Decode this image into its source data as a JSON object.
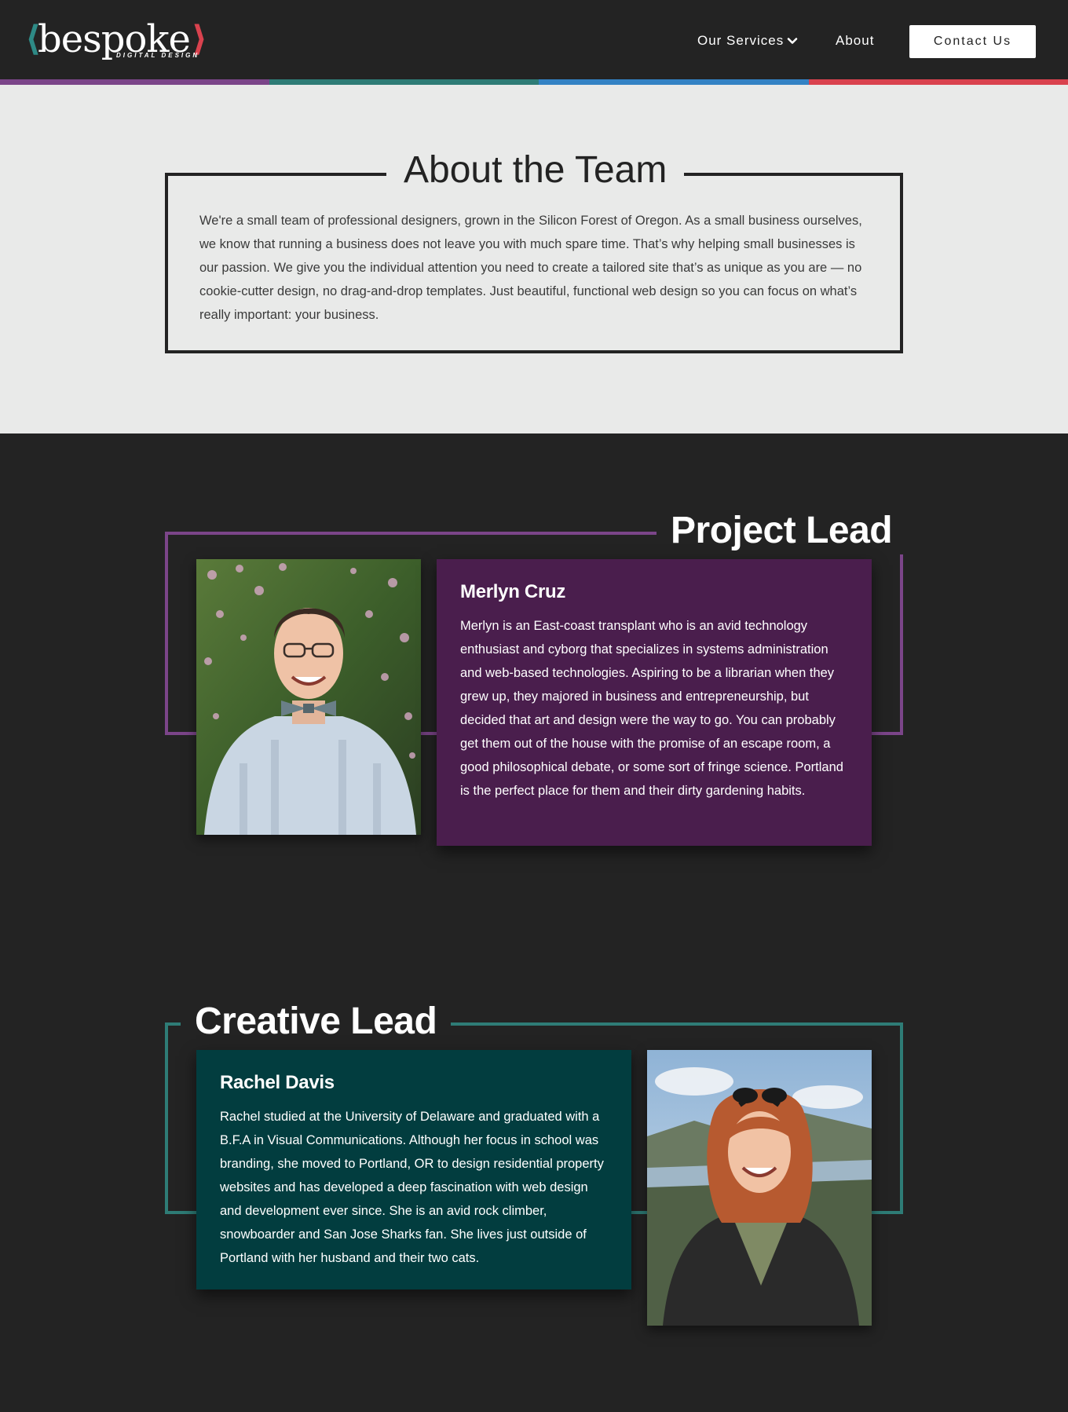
{
  "brand": {
    "logo_text": "bespoke",
    "logo_subtitle": "DIGITAL DESIGN",
    "bracket_left": "⟨",
    "bracket_right": "⟩",
    "colors": {
      "purple": "#7b4589",
      "teal": "#2e7c76",
      "blue": "#3382c4",
      "red": "#d9424e",
      "dark": "#232323",
      "light": "#e9eae9"
    }
  },
  "nav": {
    "services_label": "Our Services",
    "services_icon": "chevron-down-icon",
    "about_label": "About",
    "contact_label": "Contact Us"
  },
  "about": {
    "title": "About the Team",
    "text": "We're a small team of professional designers, grown in the Silicon Forest of Oregon. As a small business ourselves, we know that running a business does not leave you with much spare time. That’s why helping small businesses is our passion. We give you the individual attention you need to create a tailored site that’s as unique as you are — no cookie-cutter design, no drag-and-drop templates. Just beautiful, functional web design so you can focus on what’s really important: your business."
  },
  "team": [
    {
      "role": "Project Lead",
      "name": "Merlyn Cruz",
      "bio": "Merlyn is an East-coast transplant who is an avid technology enthusiast and cyborg that specializes in systems administration and web-based technologies. Aspiring to be a librarian when they grew up, they majored in business and entrepreneurship, but decided that art and design were the way to go. You can probably get them out of the house with the promise of an escape room, a good philosophical debate, or some sort of fringe science. Portland is the perfect place for them and their dirty gardening habits.",
      "card_color": "#4a1e4d",
      "frame_color": "#7b4589"
    },
    {
      "role": "Creative Lead",
      "name": "Rachel Davis",
      "bio": "Rachel studied at the University of Delaware and graduated with a B.F.A in Visual Communications. Although her focus in school was branding, she moved to Portland, OR to design residential property websites and has developed a deep fascination with web design and development ever since. She is an avid rock climber, snowboarder and San Jose Sharks fan. She lives just outside of Portland with her husband and their two cats.",
      "card_color": "#023d3f",
      "frame_color": "#2e7c76"
    }
  ]
}
